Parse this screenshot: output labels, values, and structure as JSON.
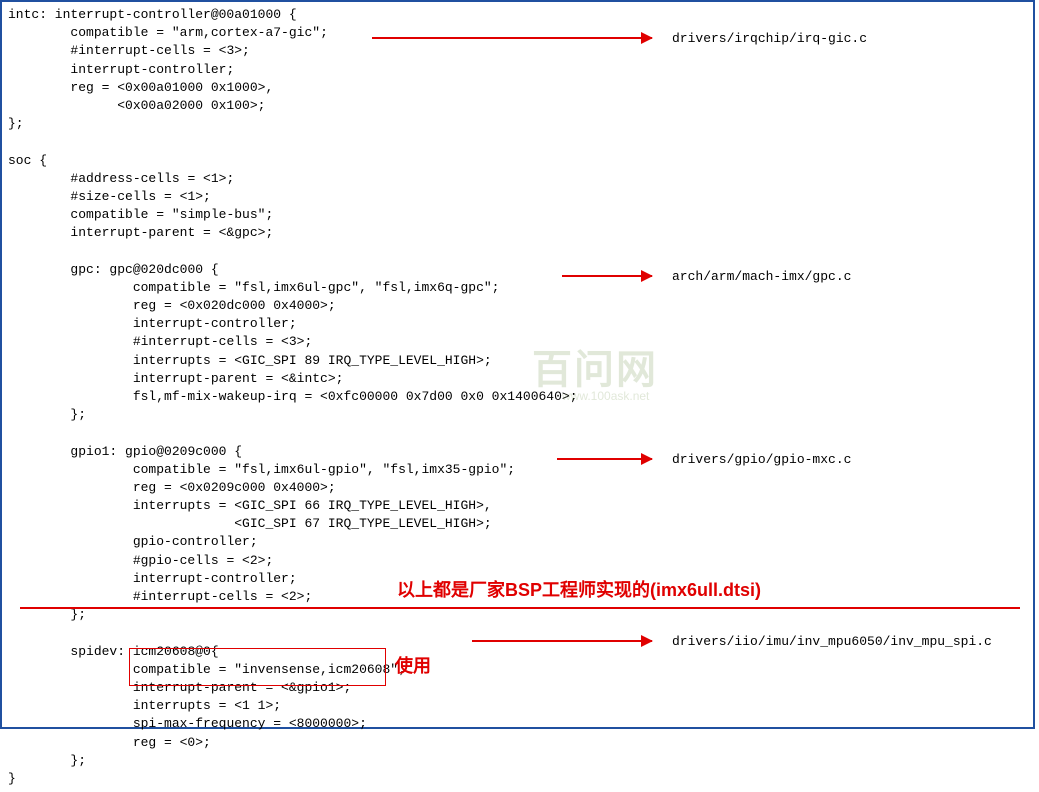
{
  "code": {
    "l1": "intc: interrupt-controller@00a01000 {",
    "l2": "compatible = \"arm,cortex-a7-gic\";",
    "l3": "#interrupt-cells = <3>;",
    "l4": "interrupt-controller;",
    "l5": "reg = <0x00a01000 0x1000>,",
    "l6": "<0x00a02000 0x100>;",
    "l7": "};",
    "l8": "soc {",
    "l9": "#address-cells = <1>;",
    "l10": "#size-cells = <1>;",
    "l11": "compatible = \"simple-bus\";",
    "l12": "interrupt-parent = <&gpc>;",
    "l13": "gpc: gpc@020dc000 {",
    "l14": "compatible = \"fsl,imx6ul-gpc\", \"fsl,imx6q-gpc\";",
    "l15": "reg = <0x020dc000 0x4000>;",
    "l16": "interrupt-controller;",
    "l17": "#interrupt-cells = <3>;",
    "l18": "interrupts = <GIC_SPI 89 IRQ_TYPE_LEVEL_HIGH>;",
    "l19": "interrupt-parent = <&intc>;",
    "l20": "fsl,mf-mix-wakeup-irq = <0xfc00000 0x7d00 0x0 0x1400640>;",
    "l21": "};",
    "l22": "gpio1: gpio@0209c000 {",
    "l23": "compatible = \"fsl,imx6ul-gpio\", \"fsl,imx35-gpio\";",
    "l24": "reg = <0x0209c000 0x4000>;",
    "l25": "interrupts = <GIC_SPI 66 IRQ_TYPE_LEVEL_HIGH>,",
    "l26": "<GIC_SPI 67 IRQ_TYPE_LEVEL_HIGH>;",
    "l27": "gpio-controller;",
    "l28": "#gpio-cells = <2>;",
    "l29": "interrupt-controller;",
    "l30": "#interrupt-cells = <2>;",
    "l31": "};",
    "l32": "spidev: icm20608@0{",
    "l33": "compatible = \"invensense,icm20608\";",
    "l34": "interrupt-parent = <&gpio1>;",
    "l35": "interrupts = <1 1>;",
    "l36": "spi-max-frequency = <8000000>;",
    "l37": "reg = <0>;",
    "l38": "};",
    "l39": "}"
  },
  "labels": {
    "r1": "drivers/irqchip/irq-gic.c",
    "r2": "arch/arm/mach-imx/gpc.c",
    "r3": "drivers/gpio/gpio-mxc.c",
    "r4": "drivers/iio/imu/inv_mpu6050/inv_mpu_spi.c"
  },
  "annotations": {
    "bsp": "以上都是厂家BSP工程师实现的(imx6ull.dtsi)",
    "use": "使用"
  },
  "watermark": {
    "main": "百问网",
    "sub": "www.100ask.net"
  }
}
